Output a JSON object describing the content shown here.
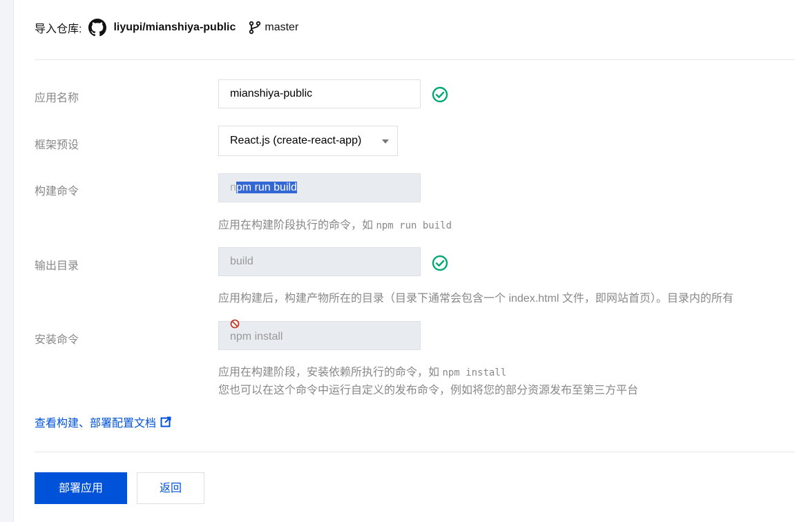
{
  "header": {
    "repo_label": "导入仓库:",
    "repo_name": "liyupi/mianshiya-public",
    "branch": "master"
  },
  "form": {
    "app_name": {
      "label": "应用名称",
      "value": "mianshiya-public",
      "status_icon": "check-circle-icon"
    },
    "framework": {
      "label": "框架预设",
      "value": "React.js (create-react-app)"
    },
    "build_command": {
      "label": "构建命令",
      "value_prefix": "n",
      "value_selected": "pm run build",
      "hint_text": "应用在构建阶段执行的命令，如 ",
      "hint_code": "npm run build"
    },
    "output_dir": {
      "label": "输出目录",
      "placeholder": "build",
      "status_icon": "check-circle-icon",
      "hint_text": "应用构建后，构建产物所在的目录（目录下通常会包含一个 index.html 文件，即网站首页）。目录内的所有"
    },
    "install_command": {
      "label": "安装命令",
      "placeholder": "npm install",
      "hint_text": "应用在构建阶段，安装依赖所执行的命令，如 ",
      "hint_code": "npm install",
      "hint_line2": "您也可以在这个命令中运行自定义的发布命令，例如将您的部分资源发布至第三方平台"
    }
  },
  "doc_link": "查看构建、部署配置文档",
  "buttons": {
    "deploy": "部署应用",
    "back": "返回"
  },
  "colors": {
    "primary": "#0052d9",
    "success": "#00a870",
    "disabled_bg": "#e8ebf0",
    "selection": "#3367d6"
  }
}
